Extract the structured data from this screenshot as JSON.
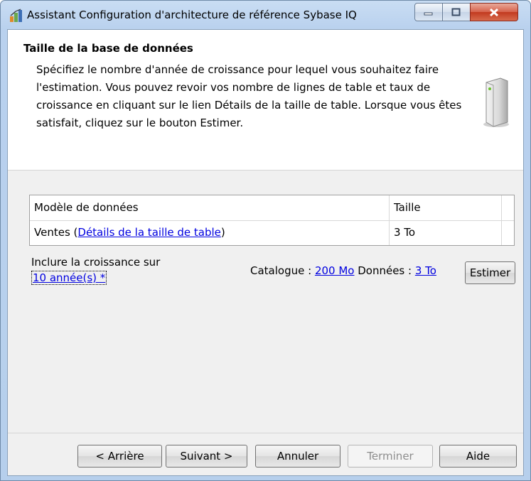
{
  "window": {
    "title": "Assistant Configuration d'architecture de référence Sybase IQ",
    "controls": {
      "minimize": "minimize-icon",
      "maximize": "maximize-icon",
      "close": "close-icon"
    }
  },
  "header": {
    "title": "Taille de la base de données",
    "description": "Spécifiez le nombre d'année de croissance pour lequel vous souhaitez faire l'estimation. Vous pouvez revoir vos nombre de lignes de table et taux de croissance en cliquant sur le lien Détails de la taille de table. Lorsque vous êtes satisfait, cliquez sur le bouton Estimer.",
    "icon": "server-icon"
  },
  "grid": {
    "columns": [
      "Modèle de données",
      "Taille"
    ],
    "rows": [
      {
        "model": "Ventes",
        "model_link_open": " (",
        "details_link": "Détails de la taille de table",
        "model_link_close": ")",
        "size": "3 To"
      }
    ]
  },
  "growth": {
    "label": "Inclure la croissance sur",
    "years_link": "10 année(s) *"
  },
  "stats": {
    "catalog_label": "Catalogue : ",
    "catalog_value": "200 Mo",
    "data_label": " Données : ",
    "data_value": "3 To",
    "estimate_button": "Estimer"
  },
  "footer": {
    "back": "< Arrière",
    "next": "Suivant >",
    "cancel": "Annuler",
    "finish": "Terminer",
    "help": "Aide"
  },
  "colors": {
    "link": "#0000e0",
    "title_bar": "#b9d1ee",
    "close_button": "#c23a1f"
  }
}
